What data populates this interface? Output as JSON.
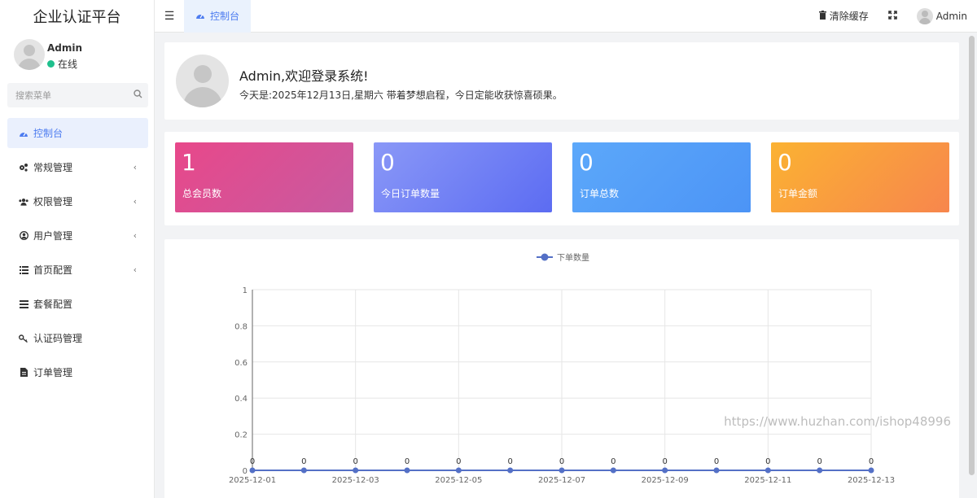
{
  "app": {
    "title": "企业认证平台"
  },
  "topbar": {
    "tab_label": "控制台",
    "clear_cache_label": "清除缓存",
    "admin_label": "Admin"
  },
  "sidebar": {
    "user_name": "Admin",
    "user_status": "在线",
    "search_placeholder": "搜索菜单",
    "items": [
      {
        "label": "控制台",
        "icon": "dashboard-icon",
        "active": true,
        "has_submenu": false
      },
      {
        "label": "常规管理",
        "icon": "cogs-icon",
        "active": false,
        "has_submenu": true
      },
      {
        "label": "权限管理",
        "icon": "users-icon",
        "active": false,
        "has_submenu": true
      },
      {
        "label": "用户管理",
        "icon": "user-circle-icon",
        "active": false,
        "has_submenu": true
      },
      {
        "label": "首页配置",
        "icon": "list-icon",
        "active": false,
        "has_submenu": true
      },
      {
        "label": "套餐配置",
        "icon": "bars-icon",
        "active": false,
        "has_submenu": false
      },
      {
        "label": "认证码管理",
        "icon": "key-icon",
        "active": false,
        "has_submenu": false
      },
      {
        "label": "订单管理",
        "icon": "file-icon",
        "active": false,
        "has_submenu": false
      }
    ]
  },
  "welcome": {
    "title": "Admin,欢迎登录系统!",
    "text": "今天是:2025年12月13日,星期六  带着梦想启程，今日定能收获惊喜硕果。"
  },
  "stats": [
    {
      "value": "1",
      "label": "总会员数",
      "colors": [
        "#e8488a",
        "#c85aa0"
      ]
    },
    {
      "value": "0",
      "label": "今日订单数量",
      "colors": [
        "#8a98f7",
        "#5c6cf2"
      ]
    },
    {
      "value": "0",
      "label": "订单总数",
      "colors": [
        "#5ca8fa",
        "#4c94f6"
      ]
    },
    {
      "value": "0",
      "label": "订单金额",
      "colors": [
        "#fbb232",
        "#f7864d"
      ]
    }
  ],
  "watermark": "https://www.huzhan.com/ishop48996",
  "colors": {
    "accent": "#4d7cf0",
    "online": "#1fc08d",
    "series": "#5470c6"
  },
  "chart_data": {
    "type": "line",
    "x": [
      "2025-12-01",
      "2025-12-02",
      "2025-12-03",
      "2025-12-04",
      "2025-12-05",
      "2025-12-06",
      "2025-12-07",
      "2025-12-08",
      "2025-12-09",
      "2025-12-10",
      "2025-12-11",
      "2025-12-12",
      "2025-12-13"
    ],
    "x_tick_labels": [
      "2025-12-01",
      "2025-12-03",
      "2025-12-05",
      "2025-12-07",
      "2025-12-09",
      "2025-12-11",
      "2025-12-13"
    ],
    "series": [
      {
        "name": "下单数量",
        "values": [
          0,
          0,
          0,
          0,
          0,
          0,
          0,
          0,
          0,
          0,
          0,
          0,
          0
        ]
      }
    ],
    "ylim": [
      0,
      1
    ],
    "y_ticks": [
      "0",
      "0.2",
      "0.4",
      "0.6",
      "0.8",
      "1"
    ],
    "legend": "top-center",
    "grid": true
  }
}
